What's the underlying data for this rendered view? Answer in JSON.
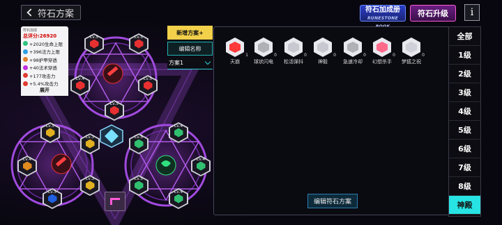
{
  "header": {
    "back_label": "符石方案",
    "book_label": "符石加成册",
    "book_sub": "RUNESTONE BOOK",
    "upgrade_label": "符石升级",
    "info_label": "i"
  },
  "score": {
    "title": "符石加成",
    "total": "总评分:26920",
    "stats": [
      {
        "text": "+2020生命上限",
        "color": "#2ec27e"
      },
      {
        "text": "+396法力上限",
        "color": "#2e9fe0"
      },
      {
        "text": "+98护甲穿透",
        "color": "#e0802e"
      },
      {
        "text": "+40法术穿透",
        "color": "#c02ee0"
      },
      {
        "text": "+177攻击力",
        "color": "#e03a2e"
      },
      {
        "text": "+5.4%攻击力",
        "color": "#e03a2e"
      }
    ],
    "expand_label": "展开"
  },
  "plan": {
    "new_label": "新增方案+",
    "edit_name_label": "编辑名称",
    "selected": "方案1"
  },
  "runes": [
    {
      "name": "天崩",
      "count": "1",
      "color": "#ff3a3a"
    },
    {
      "name": "球状闪电",
      "count": "0",
      "color": "#b0b0b8"
    },
    {
      "name": "松活弹抖",
      "count": "0",
      "color": "#c8c8d0"
    },
    {
      "name": "神毅",
      "count": "0",
      "color": "#c8c8d0"
    },
    {
      "name": "急速冷却",
      "count": "0",
      "color": "#b0b0b8"
    },
    {
      "name": "幻想杀手",
      "count": "0",
      "color": "#ff6a8a"
    },
    {
      "name": "梦狐之祝",
      "count": "0",
      "color": "#d0d0d8"
    }
  ],
  "edit_plan_label": "编辑符石方案",
  "levels": [
    "全部",
    "1级",
    "2级",
    "3级",
    "4级",
    "5级",
    "6级",
    "7级",
    "8级",
    "神殿"
  ],
  "active_level": "神殿",
  "slots": {
    "top": [
      {
        "lv": "Lv.5",
        "color": "#e83030"
      },
      {
        "lv": "Lv.5",
        "color": "#e83030"
      },
      {
        "lv": "Lv.4",
        "color": "#e83030"
      },
      {
        "lv": "Lv.5",
        "color": "#e83030"
      },
      {
        "lv": "Lv.5",
        "color": "#e83030"
      }
    ],
    "left": [
      {
        "lv": "Lv.5",
        "color": "#e0b020"
      },
      {
        "lv": "Lv.3",
        "color": "#e0b020"
      },
      {
        "lv": "Lv.4",
        "color": "#e08a20"
      },
      {
        "lv": "Lv.3",
        "color": "#e0b020"
      },
      {
        "lv": "Lv.5",
        "color": "#2060e0"
      }
    ],
    "right": [
      {
        "lv": "Lv.4",
        "color": "#30c070"
      },
      {
        "lv": "Lv.5",
        "color": "#30c070"
      },
      {
        "lv": "Lv.4",
        "color": "#30c070"
      },
      {
        "lv": "Lv.5",
        "color": "#30c070"
      },
      {
        "lv": "Lv.4",
        "color": "#30c070"
      }
    ]
  }
}
